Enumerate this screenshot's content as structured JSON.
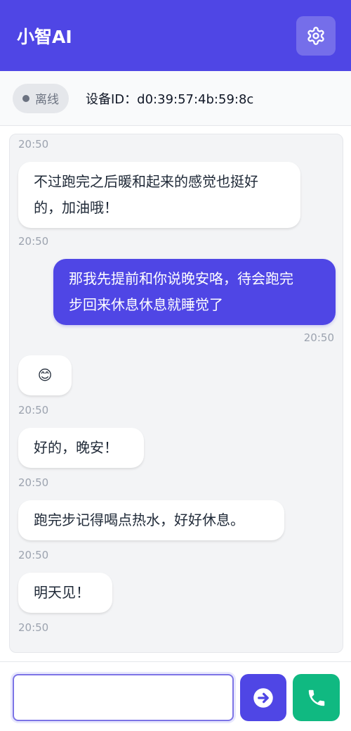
{
  "header": {
    "title": "小智AI",
    "settings_icon": "gear-icon"
  },
  "status": {
    "state": "离线",
    "device_id": "设备ID：d0:39:57:4b:59:8c"
  },
  "messages": [
    {
      "ts_top": "20:50"
    },
    {
      "role": "assistant",
      "text_line1": "不过跑完之后暖和起来的感觉也挺好",
      "text_line2": "的，加油哦！",
      "time": "20:50"
    },
    {
      "role": "user",
      "text_line1": "那我先提前和你说晚安咯，待会跑完",
      "text_line2": "步回来休息休息就睡觉了",
      "time": "20:50"
    },
    {
      "role": "assistant",
      "text": "😊",
      "time": "20:50"
    },
    {
      "role": "assistant",
      "text": "好的，晚安！",
      "time": "20:50"
    },
    {
      "role": "assistant",
      "text": "跑完步记得喝点热水，好好休息。",
      "time": "20:50"
    },
    {
      "role": "assistant",
      "text": "明天见！",
      "time": "20:50"
    }
  ],
  "input": {
    "value": "",
    "placeholder": ""
  },
  "colors": {
    "primary": "#4f46e5",
    "call": "#10b981",
    "offline_badge": "#e5e7eb"
  },
  "icons": {
    "send": "arrow-right-circle-icon",
    "call": "phone-icon"
  }
}
